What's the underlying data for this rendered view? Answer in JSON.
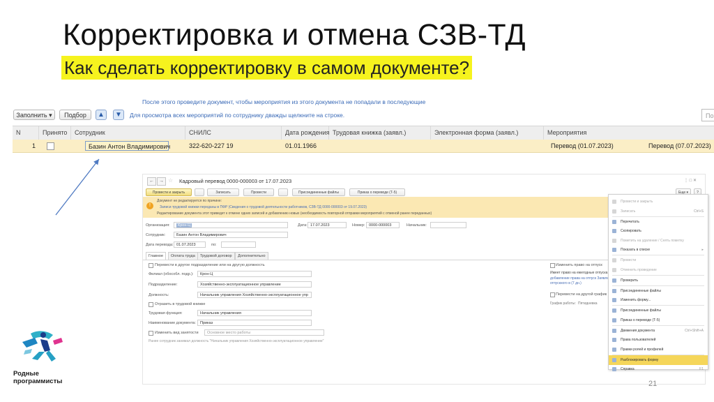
{
  "slide": {
    "title": "Корректировка и отмена СЗВ-ТД",
    "subtitle": "Как сделать корректировку в самом документе?",
    "page_number": "21",
    "logo_line1": "Родные",
    "logo_line2": "программисты"
  },
  "top": {
    "hint_top": "После этого проведите документ, чтобы мероприятия из этого документа не попадали в последующие",
    "fill_button": "Заполнить ▾",
    "select_button": "Подбор",
    "up_icon": "▲",
    "down_icon": "▼",
    "toolbar_hint": "Для просмотра всех мероприятий по сотруднику дважды щелкните на строке.",
    "search_placeholder": "Пои",
    "columns": [
      "N",
      "Принято",
      "Сотрудник",
      "СНИЛС",
      "Дата рождения",
      "Трудовая книжка (заявл.)",
      "Электронная форма (заявл.)",
      "Мероприятия"
    ],
    "row": {
      "n": "1",
      "employee": "Базин Антон Владимирович",
      "snils": "322-620-227 19",
      "birth_date": "01.01.1966",
      "event1": "Перевод (01.07.2023)",
      "event2": "Перевод (07.07.2023)"
    }
  },
  "doc": {
    "title": "Кадровый перевод 0000-000003 от 17.07.2023",
    "nav_back": "←",
    "nav_forward": "→",
    "star": "☆",
    "win_controls": "⋮  □  ✕",
    "toolbar": [
      "Провести и закрыть",
      "Записать",
      "Провести",
      "Присоединенные файлы",
      "Приказ о переводе (Т-5)"
    ],
    "more_button": "Еще ▾",
    "help_button": "?",
    "warn_line1": "Документ не редактируется по причине:",
    "warn_line2": "Записи трудовой книжки переданы в ПФР (Сведения о трудовой деятельности работников, СЗВ-ТД 0000-000003 от 19.07.2023)",
    "warn_line3": "Редактирование документа этот приведет к отмене одних записей и добавлению новых (необходимость повторной отправки мероприятий с отменой ранее переданных)",
    "org_label": "Организация:",
    "org_value": "Крон-Ц",
    "date_label": "Дата:",
    "date_value": "17.07.2023",
    "number_label": "Номер:",
    "number_value": "0000-000003",
    "chief_label": "Начальник:",
    "employee_label": "Сотрудник:",
    "employee_value": "Базин Антон Владимирович",
    "transfer_date_label": "Дата перевода:",
    "transfer_date_value": "01.07.2023",
    "to_label": "по:",
    "tabs": [
      "Главное",
      "Оплата труда",
      "Трудовой договор",
      "Дополнительно"
    ],
    "check_transfer": "Перевести в другое подразделение или на другую должность",
    "branch_label": "Филиал (обособл. подр.):",
    "branch_value": "Крон-Ц",
    "division_label": "Подразделение:",
    "division_value": "Хозяйственно-эксплуатационное управление",
    "position_label": "Должность:",
    "position_value": "Начальник управления Хозяйственно-эксплуатационное упр",
    "check_book": "Отразить в трудовой книжке",
    "labor_function_label": "Трудовая функция:",
    "labor_function_value": "Начальник управления",
    "doc_name_label": "Наименование документа:",
    "doc_name_value": "Приказ",
    "check_employment": "Изменить вид занятости",
    "employment_value": "Основное место работы",
    "prev_position_note": "Ранее сотрудник занимал должность \"Начальник управления Хозяйственно-эксплуатационное управление\"",
    "right_check1": "Изменить право на отпуск",
    "right_note1": "Имеет право на ежегодные отпуска",
    "right_link": "добавление права на отпуск Заявление",
    "right_link2": "отпускного в (7 дн.)",
    "right_check2": "Перевести на другой график",
    "schedule_label": "График работы:",
    "schedule_value": "Пятидневка"
  },
  "menu": {
    "items": [
      {
        "label": "Провести и закрыть",
        "shortcut": "",
        "state": "disabled"
      },
      {
        "label": "Записать",
        "shortcut": "Ctrl+S",
        "state": "disabled"
      },
      {
        "label": "Перечитать",
        "shortcut": "",
        "state": "normal"
      },
      {
        "label": "Скопировать",
        "shortcut": "",
        "state": "normal"
      },
      {
        "label": "Пометить на удаление / Снять пометку",
        "shortcut": "",
        "state": "disabled"
      },
      {
        "label": "Показать в списке",
        "shortcut": "▸",
        "state": "normal"
      },
      {
        "label": "Провести",
        "shortcut": "",
        "state": "disabled"
      },
      {
        "label": "Отменить проведение",
        "shortcut": "",
        "state": "disabled"
      },
      {
        "label": "Проверить",
        "shortcut": "",
        "state": "normal"
      },
      {
        "label": "Присоединенные файлы",
        "shortcut": "",
        "state": "normal"
      },
      {
        "label": "Изменить форму...",
        "shortcut": "",
        "state": "normal"
      },
      {
        "label": "Присоединенные файлы",
        "shortcut": "",
        "state": "normal"
      },
      {
        "label": "Приказ о переводе (Т-5)",
        "shortcut": "",
        "state": "normal"
      },
      {
        "label": "Движения документа",
        "shortcut": "Ctrl+Shift+A",
        "state": "normal"
      },
      {
        "label": "Права пользователей",
        "shortcut": "",
        "state": "normal"
      },
      {
        "label": "Правки ролей и профилей",
        "shortcut": "",
        "state": "normal"
      },
      {
        "label": "Разблокировать форму",
        "shortcut": "",
        "state": "highlight"
      },
      {
        "label": "Справка",
        "shortcut": "F1",
        "state": "normal"
      }
    ]
  }
}
